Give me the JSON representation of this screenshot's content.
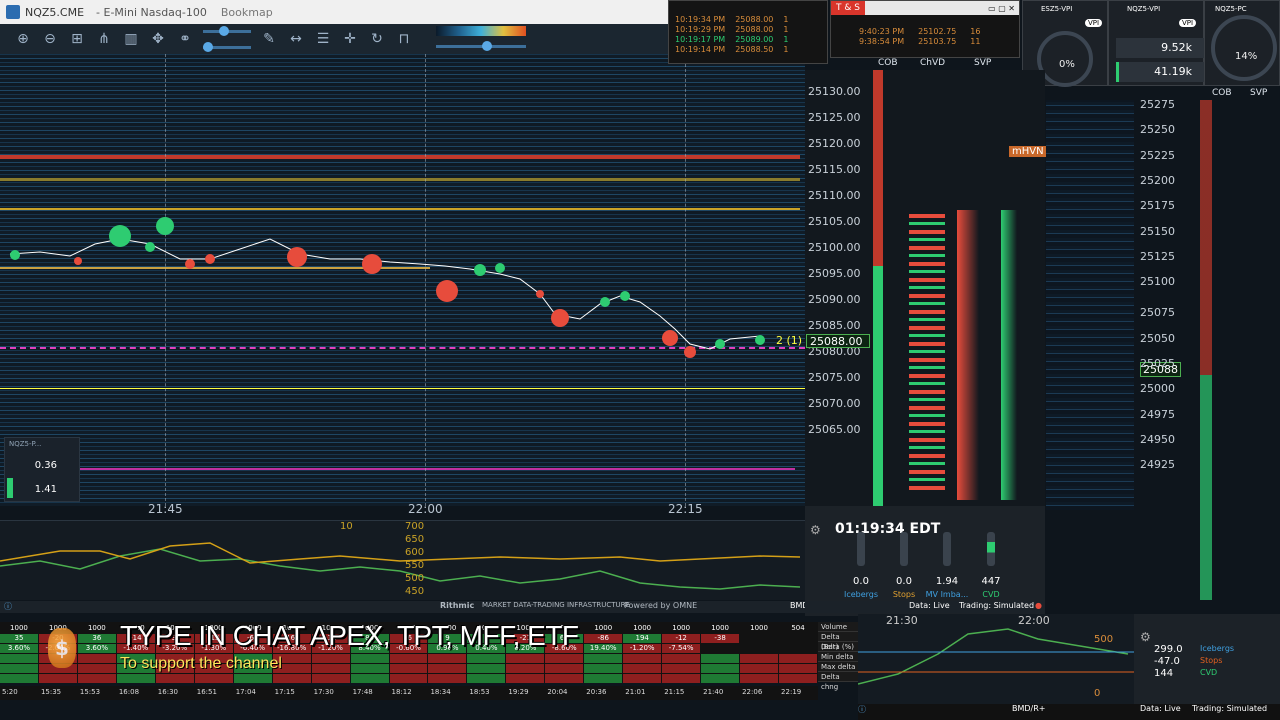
{
  "title_bar": {
    "symbol": "NQZ5.CME",
    "name": "- E-Mini Nasdaq-100",
    "app": "Bookmap"
  },
  "time_axis": [
    "21:45",
    "22:00",
    "22:15"
  ],
  "ladder": {
    "headers": [
      "COB",
      "ChVD",
      "SVP"
    ],
    "prices": [
      "25130.00",
      "25125.00",
      "25120.00",
      "25115.00",
      "25110.00",
      "25105.00",
      "25100.00",
      "25095.00",
      "25090.00",
      "25088.00",
      "25085.00",
      "25080.00",
      "25075.00",
      "25070.00",
      "25065.00"
    ],
    "current_price": "25088.00",
    "mhvn_label": "mHVN",
    "order_marker": "2 (1)"
  },
  "right_ladder": {
    "headers": [
      "COB",
      "SVP"
    ],
    "prices": [
      "25275",
      "25250",
      "25225",
      "25200",
      "25175",
      "25150",
      "25125",
      "25100",
      "25088",
      "25075",
      "25050",
      "25025",
      "25000",
      "24975",
      "24950",
      "24925"
    ]
  },
  "tas_window": {
    "rows": [
      {
        "time": "10:19:34 PM",
        "price": "25088.00",
        "size": "1"
      },
      {
        "time": "10:19:29 PM",
        "price": "25088.00",
        "size": "1"
      },
      {
        "time": "10:19:17 PM",
        "price": "25089.00",
        "size": "1"
      },
      {
        "time": "10:19:14 PM",
        "price": "25088.50",
        "size": "1"
      }
    ]
  },
  "tas2_window": {
    "title": "T & S",
    "rows": [
      {
        "time": "9:40:23 PM",
        "price": "25102.75",
        "size": "16"
      },
      {
        "time": "9:38:54 PM",
        "price": "25103.75",
        "size": "11"
      }
    ]
  },
  "gauges": {
    "es_title": "ESZ5-VPI",
    "nq_title": "NQZ5-VPI",
    "pc_title": "NQZ5-PC",
    "vpi_label": "VPI",
    "es_pct": "0%",
    "vol_a": "9.52k",
    "vol_b": "41.19k",
    "pc_pct": "14%"
  },
  "mini_widget": {
    "title": "NQZ5-P...",
    "val1": "0.36",
    "val2": "1.41"
  },
  "indicator": {
    "levels": [
      "700",
      "650",
      "600",
      "550",
      "500",
      "450"
    ],
    "value": "10"
  },
  "clock_panel": {
    "time": "01:19:34 EDT",
    "values": [
      "0.0",
      "0.0",
      "1.94",
      "447"
    ],
    "labels": [
      "Icebergs",
      "Stops",
      "MV Imba...",
      "CVD"
    ],
    "status_live": "Data: Live",
    "status_trading": "Trading: Simulated"
  },
  "status_bar": {
    "provider": "Rithmic",
    "tagline": "MARKET DATA-TRADING INFRASTRUCTURE",
    "powered": "Powered by OMNE",
    "bmd": "BMD/R+"
  },
  "overlay": {
    "main": "TYPE IN CHAT APEX, TPT, MFF, ETF",
    "sub": "To support the channel"
  },
  "grid": {
    "row_labels": [
      "Volume",
      "Delta (Bar)",
      "Delta (%)",
      "Min delta",
      "Max delta",
      "Delta chng"
    ],
    "times": [
      "5:20",
      "15:35",
      "15:53",
      "16:08",
      "16:30",
      "16:51",
      "17:04",
      "17:15",
      "17:30",
      "17:48",
      "18:12",
      "18:34",
      "18:53",
      "19:29",
      "20:04",
      "20:36",
      "21:01",
      "21:15",
      "21:40",
      "22:06",
      "22:19"
    ],
    "top_row": [
      "1000",
      "1000",
      "1000",
      "1000",
      "1000",
      "1000",
      "1000",
      "1000",
      "1000",
      "1000",
      "1000",
      "1000",
      "1000",
      "1000",
      "1000",
      "1000",
      "1000",
      "1000",
      "1000",
      "1000",
      "504"
    ],
    "delta_row": [
      "35",
      "-20",
      "36",
      "-14",
      "-32",
      "-13",
      "-64",
      "-168",
      "-12",
      "84",
      "-6",
      "9",
      "4",
      "-21",
      "62",
      "-86",
      "194",
      "-12",
      "-38"
    ],
    "pct_row": [
      "3.60%",
      "-2.00%",
      "3.60%",
      "-1.40%",
      "-3.20%",
      "-1.30%",
      "-6.40%",
      "-16.80%",
      "-1.20%",
      "8.40%",
      "-0.60%",
      "0.90%",
      "0.40%",
      "6.20%",
      "-8.60%",
      "19.40%",
      "-1.20%",
      "-7.54%"
    ]
  },
  "bottom_right": {
    "time_ticks": [
      "21:30",
      "22:00"
    ],
    "values": [
      "299.0",
      "-47.0",
      "144"
    ],
    "labels": [
      "Icebergs",
      "Stops",
      "CVD"
    ],
    "status_live": "Data: Live",
    "status_trading": "Trading: Simulated",
    "bmd": "BMD/R+",
    "level": "500",
    "zero": "0"
  },
  "colors": {
    "bid": "#2ecc71",
    "ask": "#e74c3c",
    "heat_hi": "#e0c040",
    "heat_mid": "#1f5f8b",
    "accent_magenta": "#e040c0",
    "price_yellow": "#ffff40"
  }
}
